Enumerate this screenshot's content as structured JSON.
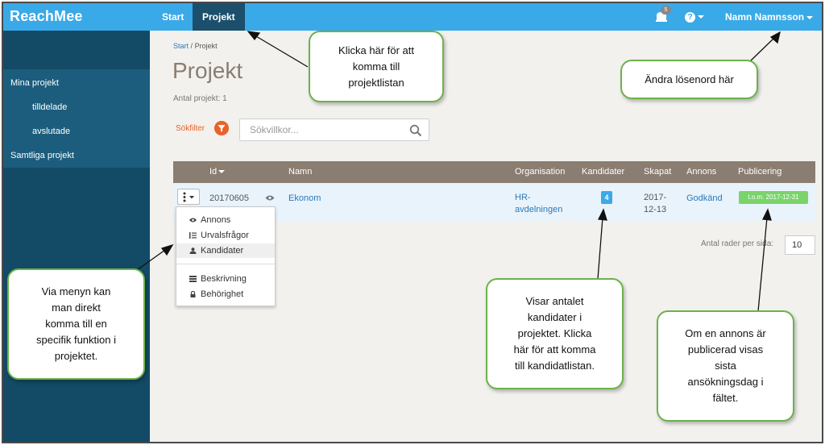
{
  "header": {
    "logo": "ReachMee",
    "nav": [
      {
        "label": "Start"
      },
      {
        "label": "Projekt"
      }
    ],
    "notification_count": "5",
    "help_icon": "help-icon",
    "user_name": "Namn Namnsson"
  },
  "sidebar": {
    "items": [
      {
        "label": "Mina projekt"
      },
      {
        "label": "tilldelade"
      },
      {
        "label": "avslutade"
      },
      {
        "label": "Samtliga projekt"
      }
    ]
  },
  "main": {
    "breadcrumb": {
      "root": "Start",
      "separator": "/",
      "current": "Projekt"
    },
    "title": "Projekt",
    "count_text": "Antal projekt: 1",
    "filter_label": "Sökfilter",
    "search_placeholder": "Sökvillkor..."
  },
  "table": {
    "columns": [
      "Id",
      "Namn",
      "Organisation",
      "Kandidater",
      "Skapat",
      "Annons",
      "Publicering"
    ],
    "rows": [
      {
        "id": "20170605",
        "name": "Ekonom",
        "organisation_line1": "HR-",
        "organisation_line2": "avdelningen",
        "candidates": "4",
        "created_line1": "2017-",
        "created_line2": "12-13",
        "ad": "Godkänd",
        "publishing": "t.o.m. 2017-12-31"
      }
    ],
    "rows_per_page_label": "Antal rader per sida:",
    "rows_per_page": "10"
  },
  "row_menu": {
    "items": [
      {
        "label": "Annons",
        "icon": "eye-icon"
      },
      {
        "label": "Urvalsfrågor",
        "icon": "list-icon"
      },
      {
        "label": "Kandidater",
        "icon": "user-icon"
      },
      {
        "label": "Beskrivning",
        "icon": "description-icon"
      },
      {
        "label": "Behörighet",
        "icon": "lock-icon"
      }
    ]
  },
  "callouts": {
    "project_list": [
      "Klicka här för att",
      "komma till",
      "projektlistan"
    ],
    "password": [
      "Ändra lösenord här"
    ],
    "menu": [
      "Via menyn kan",
      "man direkt",
      "komma till en",
      "specifik funktion i",
      "projektet."
    ],
    "candidates": [
      "Visar antalet",
      "kandidater i",
      "projektet. Klicka",
      "här för att komma",
      "till kandidatlistan."
    ],
    "publishing": [
      "Om en annons är",
      "publicerad visas",
      "sista",
      "ansökningsdag i",
      "fältet."
    ]
  },
  "colors": {
    "topbar": "#3aa9e8",
    "sidebar": "#134a66",
    "table_header": "#8a7d71",
    "accent_orange": "#e8632b",
    "callout_border": "#6cb24a",
    "published": "#7bd36b"
  }
}
